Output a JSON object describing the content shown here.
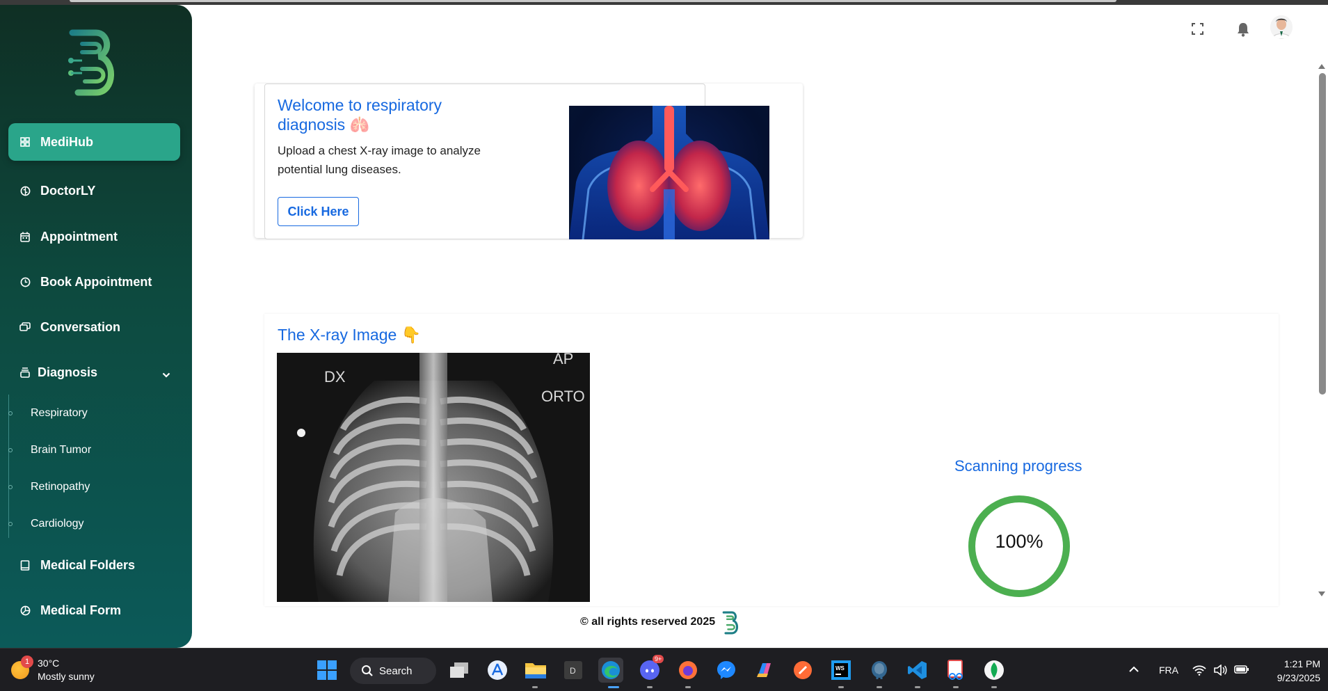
{
  "sidebar": {
    "items": [
      {
        "label": "MediHub",
        "icon": "grid-icon"
      },
      {
        "label": "DoctorLY",
        "icon": "brain-icon"
      },
      {
        "label": "Appointment",
        "icon": "calendar-icon"
      },
      {
        "label": "Book Appointment",
        "icon": "clock-icon"
      },
      {
        "label": "Conversation",
        "icon": "chat-icon"
      },
      {
        "label": "Diagnosis",
        "icon": "stack-icon"
      },
      {
        "label": "Medical Folders",
        "icon": "folder-icon"
      },
      {
        "label": "Medical Form",
        "icon": "pie-icon"
      }
    ],
    "diagnosis_sub": [
      "Respiratory",
      "Brain Tumor",
      "Retinopathy",
      "Cardiology"
    ]
  },
  "welcome": {
    "title": "Welcome to respiratory diagnosis 🫁",
    "description": "Upload a chest X-ray image to analyze potential lung diseases.",
    "button": "Click Here"
  },
  "xray": {
    "title": "The X-ray Image 👇",
    "labels": {
      "dx": "DX",
      "ap": "AP",
      "orto": "ORTO"
    }
  },
  "scan": {
    "title": "Scanning progress",
    "progress_text": "100%",
    "progress_fraction": 1.0,
    "ring_color": "#4caf50"
  },
  "footer": {
    "text": "© all rights reserved 2025"
  },
  "taskbar": {
    "weather_temp": "30°C",
    "weather_desc": "Mostly sunny",
    "weather_badge": "1",
    "search_label": "Search",
    "discord_badge": "9+",
    "language": "FRA",
    "time": "1:21 PM",
    "date": "9/23/2025"
  },
  "colors": {
    "accent": "#1769e0",
    "sidebar_active": "#2aa58a",
    "sidebar_top": "#0f2f24",
    "sidebar_bottom": "#0c5a59"
  }
}
